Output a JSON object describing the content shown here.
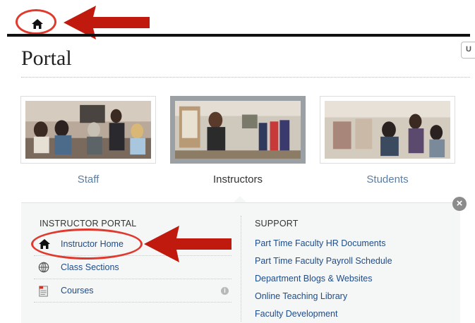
{
  "header": {
    "right_button_label": "U"
  },
  "page": {
    "title": "Portal"
  },
  "tiles": [
    {
      "label": "Staff",
      "active": false
    },
    {
      "label": "Instructors",
      "active": true
    },
    {
      "label": "Students",
      "active": false
    }
  ],
  "panel": {
    "left_heading": "INSTRUCTOR PORTAL",
    "items": [
      {
        "label": "Instructor Home",
        "icon": "home-icon"
      },
      {
        "label": "Class Sections",
        "icon": "globe-icon"
      },
      {
        "label": "Courses",
        "icon": "document-icon",
        "info_badge": "i"
      }
    ],
    "right_heading": "SUPPORT",
    "support_links": [
      "Part Time Faculty HR Documents",
      "Part Time Faculty Payroll Schedule",
      "Department Blogs & Websites",
      "Online Teaching Library",
      "Faculty Development"
    ],
    "close_symbol": "×"
  },
  "colors": {
    "annotation_red": "#e0392d",
    "arrow_red": "#c01a0e",
    "link_blue": "#1e4c8a",
    "active_tile_border": "#9aa0a3"
  }
}
